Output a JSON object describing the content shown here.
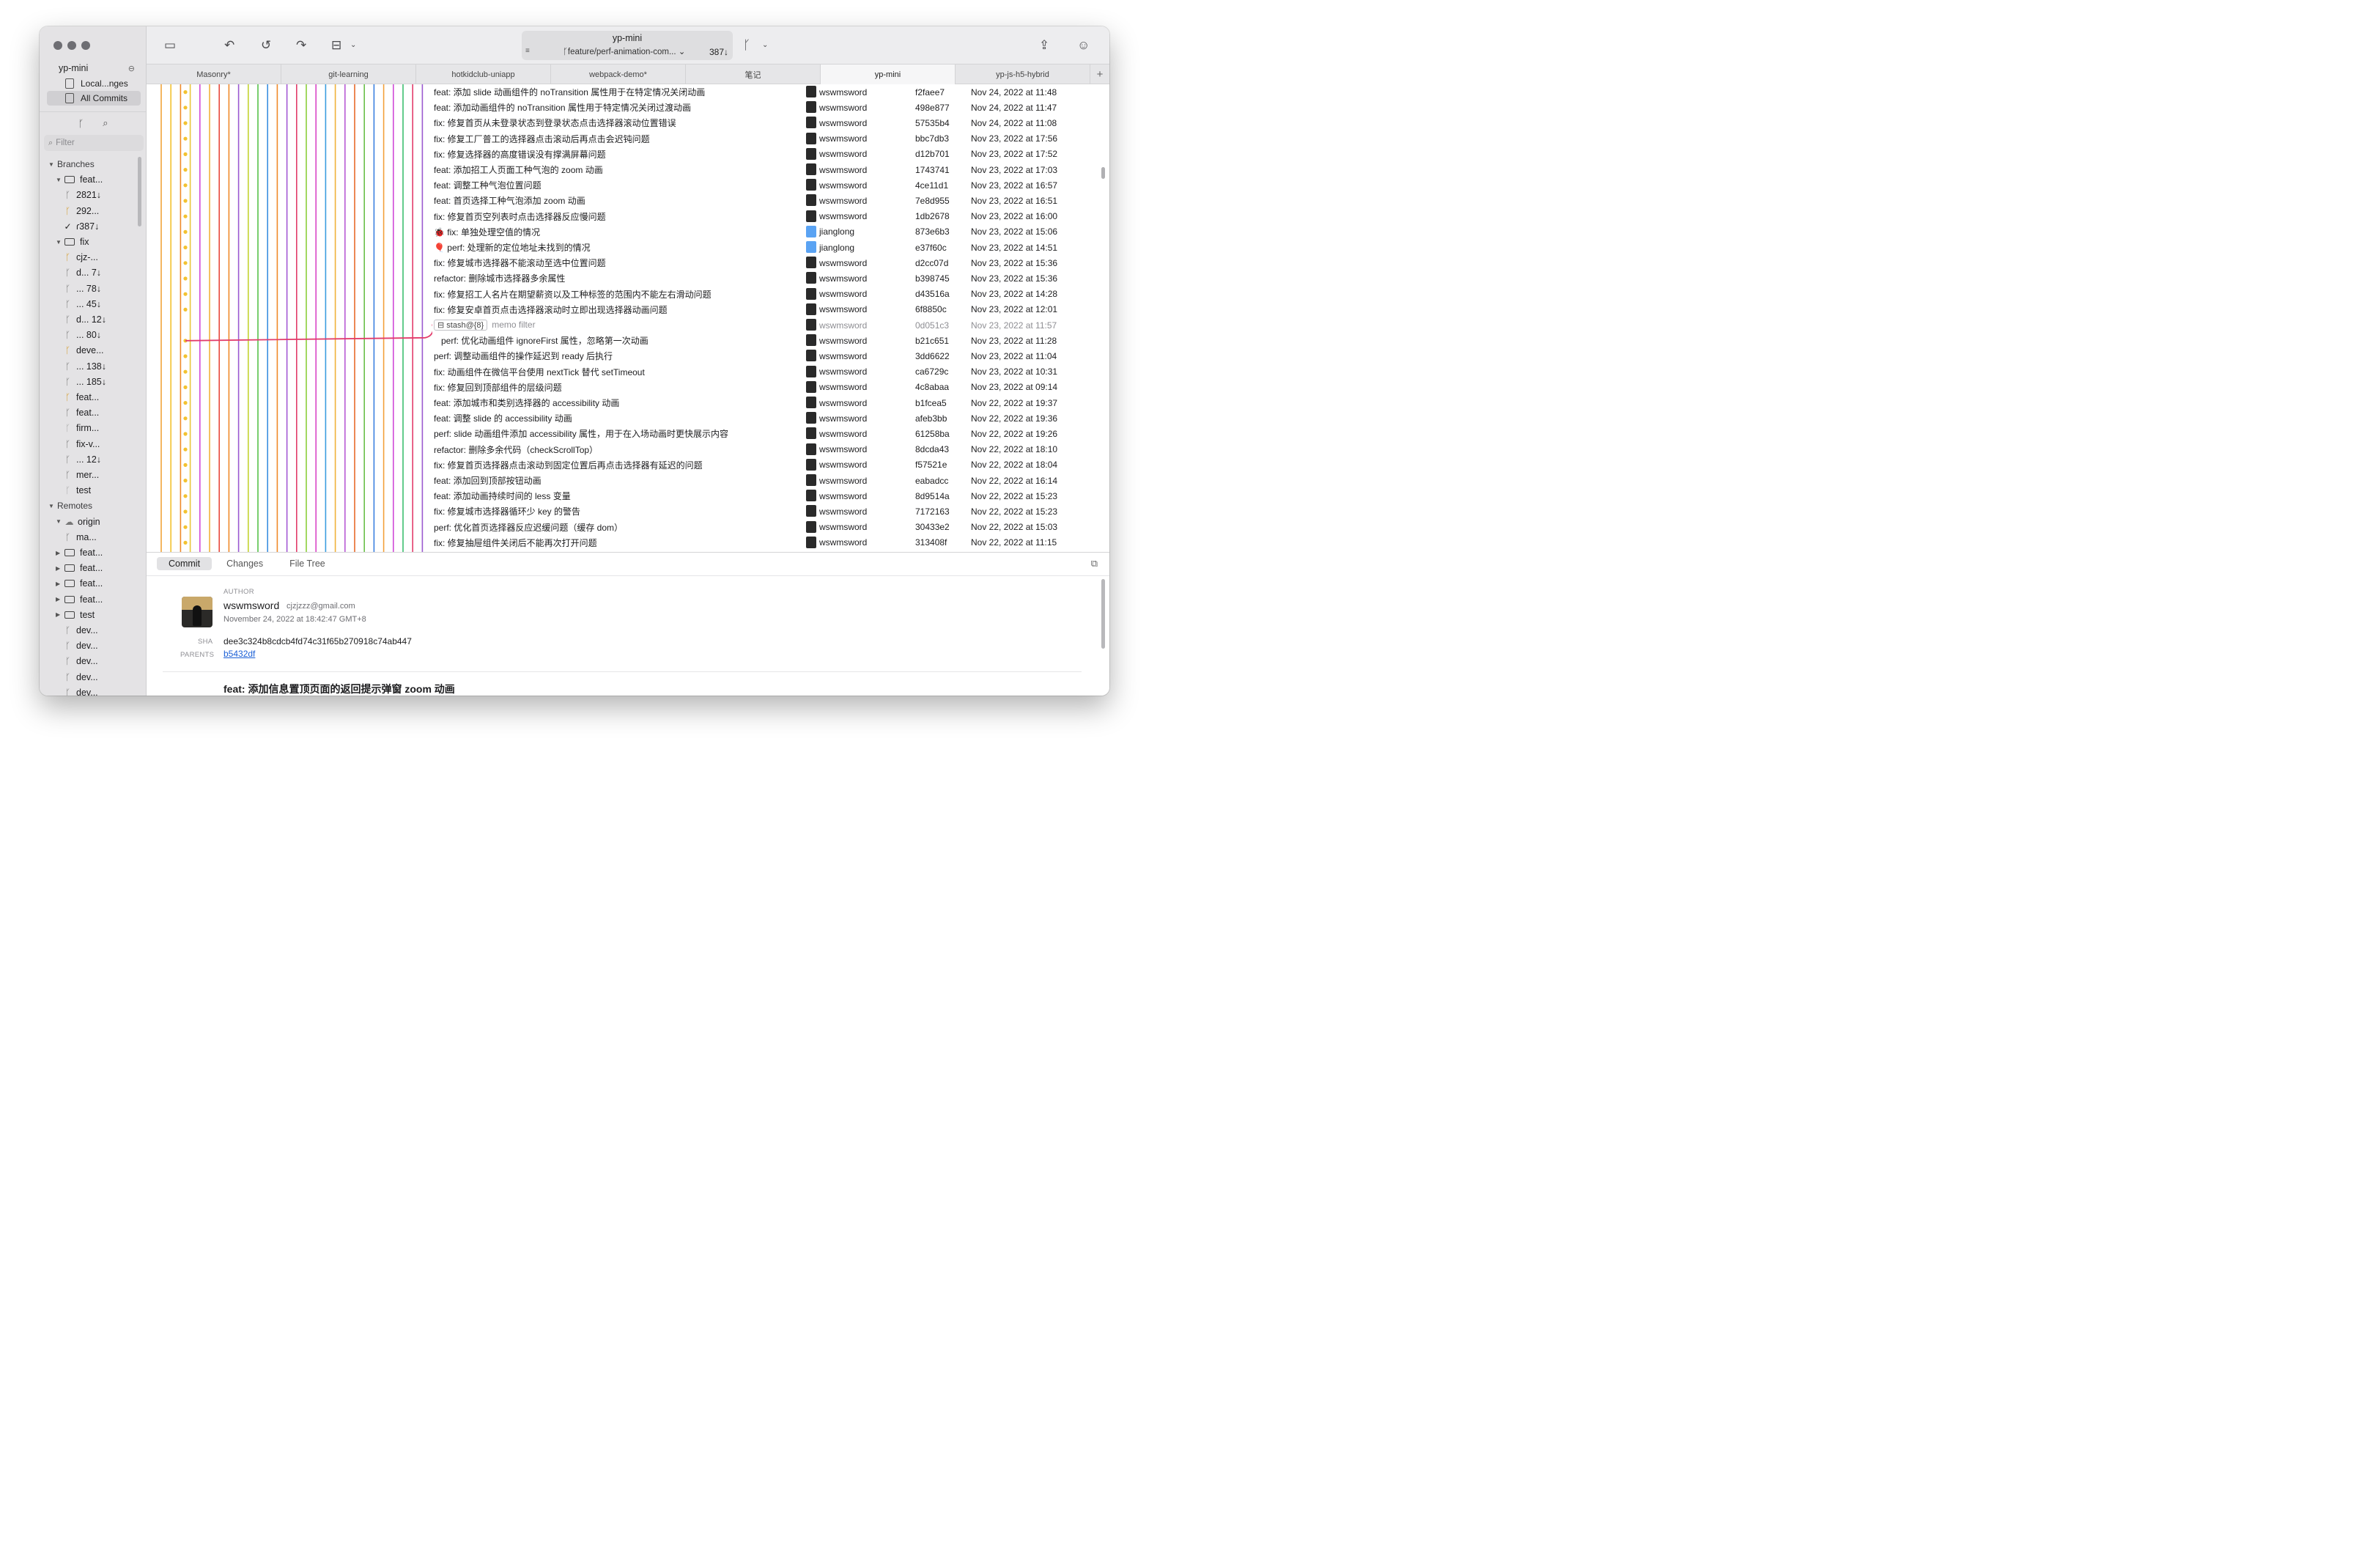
{
  "window": {
    "repo_name": "yp-mini"
  },
  "sidebar": {
    "repo_title": "yp-mini",
    "items": [
      {
        "label": "Local...nges"
      },
      {
        "label": "All Commits"
      }
    ],
    "filter_placeholder": "Filter",
    "sections": {
      "branches": "Branches",
      "remotes": "Remotes"
    },
    "tree": [
      {
        "label": "Branches",
        "kind": "header",
        "indent": 0
      },
      {
        "label": "feat...",
        "kind": "folder",
        "indent": 1
      },
      {
        "label": "2821↓",
        "kind": "branch",
        "indent": 2
      },
      {
        "label": "292...",
        "kind": "branch-warn",
        "indent": 2
      },
      {
        "label": "ɾ387↓",
        "kind": "current",
        "indent": 2
      },
      {
        "label": "fix",
        "kind": "folder",
        "indent": 1
      },
      {
        "label": "cjz-...",
        "kind": "branch-warn",
        "indent": 2
      },
      {
        "label": "d...  7↓",
        "kind": "branch",
        "indent": 2
      },
      {
        "label": "...  78↓",
        "kind": "branch",
        "indent": 2
      },
      {
        "label": "...  45↓",
        "kind": "branch",
        "indent": 2
      },
      {
        "label": "d... 12↓",
        "kind": "branch",
        "indent": 2
      },
      {
        "label": "...  80↓",
        "kind": "branch",
        "indent": 2
      },
      {
        "label": "deve...",
        "kind": "branch-warn",
        "indent": 2
      },
      {
        "label": "... 138↓",
        "kind": "branch",
        "indent": 2
      },
      {
        "label": "... 185↓",
        "kind": "branch",
        "indent": 2
      },
      {
        "label": "feat...",
        "kind": "branch-warn",
        "indent": 2
      },
      {
        "label": "feat...",
        "kind": "branch",
        "indent": 2
      },
      {
        "label": "firm...",
        "kind": "branch-dim",
        "indent": 2
      },
      {
        "label": "fix-v...",
        "kind": "branch",
        "indent": 2
      },
      {
        "label": "...  12↓",
        "kind": "branch",
        "indent": 2
      },
      {
        "label": "mer...",
        "kind": "branch",
        "indent": 2
      },
      {
        "label": "test",
        "kind": "branch-dim",
        "indent": 2
      },
      {
        "label": "Remotes",
        "kind": "header",
        "indent": 0
      },
      {
        "label": "origin",
        "kind": "remote",
        "indent": 1
      },
      {
        "label": "ma...",
        "kind": "branch",
        "indent": 2
      },
      {
        "label": "feat...",
        "kind": "folder-closed",
        "indent": 1
      },
      {
        "label": "feat...",
        "kind": "folder-closed",
        "indent": 1
      },
      {
        "label": "feat...",
        "kind": "folder-closed",
        "indent": 1
      },
      {
        "label": "feat...",
        "kind": "folder-closed",
        "indent": 1
      },
      {
        "label": "test",
        "kind": "folder-closed",
        "indent": 1
      },
      {
        "label": "dev...",
        "kind": "branch",
        "indent": 2
      },
      {
        "label": "dev...",
        "kind": "branch",
        "indent": 2
      },
      {
        "label": "dev...",
        "kind": "branch",
        "indent": 2
      },
      {
        "label": "dev...",
        "kind": "branch",
        "indent": 2
      },
      {
        "label": "dev...",
        "kind": "branch",
        "indent": 2
      }
    ]
  },
  "toolbar": {
    "title": "yp-mini",
    "branch": "feature/perf-animation-com...",
    "behind": "387↓"
  },
  "tabs": [
    {
      "label": "Masonry*",
      "active": false
    },
    {
      "label": "git-learning",
      "active": false
    },
    {
      "label": "hotkidclub-uniapp",
      "active": false
    },
    {
      "label": "webpack-demo*",
      "active": false
    },
    {
      "label": "笔记",
      "active": false
    },
    {
      "label": "yp-mini",
      "active": true
    },
    {
      "label": "yp-js-h5-hybrid",
      "active": false
    },
    {
      "label": "+",
      "active": false
    }
  ],
  "commits": [
    {
      "msg": "feat: 添加 slide 动画组件的 noTransition 属性用于在特定情况关闭动画",
      "author": "wswmsword",
      "sha": "f2faee7",
      "date": "Nov 24, 2022 at 11:48"
    },
    {
      "msg": "feat: 添加动画组件的 noTransition 属性用于特定情况关闭过渡动画",
      "author": "wswmsword",
      "sha": "498e877",
      "date": "Nov 24, 2022 at 11:47"
    },
    {
      "msg": "fix: 修复首页从未登录状态到登录状态点击选择器滚动位置错误",
      "author": "wswmsword",
      "sha": "57535b4",
      "date": "Nov 24, 2022 at 11:08"
    },
    {
      "msg": "fix: 修复工厂普工的选择器点击滚动后再点击会迟钝问题",
      "author": "wswmsword",
      "sha": "bbc7db3",
      "date": "Nov 23, 2022 at 17:56"
    },
    {
      "msg": "fix: 修复选择器的高度错误没有撑满屏幕问题",
      "author": "wswmsword",
      "sha": "d12b701",
      "date": "Nov 23, 2022 at 17:52"
    },
    {
      "msg": "feat: 添加招工人页面工种气泡的 zoom 动画",
      "author": "wswmsword",
      "sha": "1743741",
      "date": "Nov 23, 2022 at 17:03"
    },
    {
      "msg": "feat: 调整工种气泡位置问题",
      "author": "wswmsword",
      "sha": "4ce11d1",
      "date": "Nov 23, 2022 at 16:57"
    },
    {
      "msg": "feat: 首页选择工种气泡添加 zoom 动画",
      "author": "wswmsword",
      "sha": "7e8d955",
      "date": "Nov 23, 2022 at 16:51"
    },
    {
      "msg": "fix: 修复首页空列表时点击选择器反应慢问题",
      "author": "wswmsword",
      "sha": "1db2678",
      "date": "Nov 23, 2022 at 16:00"
    },
    {
      "msg": "🐞 fix: 单独处理空值的情况",
      "author": "jianglong",
      "sha": "873e6b3",
      "date": "Nov 23, 2022 at 15:06"
    },
    {
      "msg": "🎈 perf: 处理新的定位地址未找到的情况",
      "author": "jianglong",
      "sha": "e37f60c",
      "date": "Nov 23, 2022 at 14:51"
    },
    {
      "msg": "fix: 修复城市选择器不能滚动至选中位置问题",
      "author": "wswmsword",
      "sha": "d2cc07d",
      "date": "Nov 23, 2022 at 15:36"
    },
    {
      "msg": "refactor: 删除城市选择器多余属性",
      "author": "wswmsword",
      "sha": "b398745",
      "date": "Nov 23, 2022 at 15:36"
    },
    {
      "msg": "fix: 修复招工人名片在期望薪资以及工种标签的范围内不能左右滑动问题",
      "author": "wswmsword",
      "sha": "d43516a",
      "date": "Nov 23, 2022 at 14:28"
    },
    {
      "msg": "fix: 修复安卓首页点击选择器滚动时立即出现选择器动画问题",
      "author": "wswmsword",
      "sha": "6f8850c",
      "date": "Nov 23, 2022 at 12:01"
    },
    {
      "msg": "memo filter",
      "stash": "stash@{8}",
      "author": "wswmsword",
      "sha": "0d051c3",
      "date": "Nov 23, 2022 at 11:57"
    },
    {
      "msg": "perf: 优化动画组件 ignoreFirst 属性，忽略第一次动画",
      "author": "wswmsword",
      "sha": "b21c651",
      "date": "Nov 23, 2022 at 11:28"
    },
    {
      "msg": "perf: 调整动画组件的操作延迟到 ready 后执行",
      "author": "wswmsword",
      "sha": "3dd6622",
      "date": "Nov 23, 2022 at 11:04"
    },
    {
      "msg": "fix: 动画组件在微信平台使用 nextTick 替代 setTimeout",
      "author": "wswmsword",
      "sha": "ca6729c",
      "date": "Nov 23, 2022 at 10:31"
    },
    {
      "msg": "fix: 修复回到顶部组件的层级问题",
      "author": "wswmsword",
      "sha": "4c8abaa",
      "date": "Nov 23, 2022 at 09:14"
    },
    {
      "msg": "feat: 添加城市和类别选择器的 accessibility 动画",
      "author": "wswmsword",
      "sha": "b1fcea5",
      "date": "Nov 22, 2022 at 19:37"
    },
    {
      "msg": "feat: 调整 slide 的 accessibility 动画",
      "author": "wswmsword",
      "sha": "afeb3bb",
      "date": "Nov 22, 2022 at 19:36"
    },
    {
      "msg": "perf: slide 动画组件添加 accessibility 属性，用于在入场动画时更快展示内容",
      "author": "wswmsword",
      "sha": "61258ba",
      "date": "Nov 22, 2022 at 19:26"
    },
    {
      "msg": "refactor: 删除多余代码（checkScrollTop）",
      "author": "wswmsword",
      "sha": "8dcda43",
      "date": "Nov 22, 2022 at 18:10"
    },
    {
      "msg": "fix: 修复首页选择器点击滚动到固定位置后再点击选择器有延迟的问题",
      "author": "wswmsword",
      "sha": "f57521e",
      "date": "Nov 22, 2022 at 18:04"
    },
    {
      "msg": "feat: 添加回到顶部按钮动画",
      "author": "wswmsword",
      "sha": "eabadcc",
      "date": "Nov 22, 2022 at 16:14"
    },
    {
      "msg": "feat: 添加动画持续时间的 less 变量",
      "author": "wswmsword",
      "sha": "8d9514a",
      "date": "Nov 22, 2022 at 15:23"
    },
    {
      "msg": "fix: 修复城市选择器循环少 key 的警告",
      "author": "wswmsword",
      "sha": "7172163",
      "date": "Nov 22, 2022 at 15:23"
    },
    {
      "msg": "perf: 优化首页选择器反应迟缓问题（缓存 dom）",
      "author": "wswmsword",
      "sha": "30433e2",
      "date": "Nov 22, 2022 at 15:03"
    },
    {
      "msg": "fix: 修复抽屉组件关闭后不能再次打开问题",
      "author": "wswmsword",
      "sha": "313408f",
      "date": "Nov 22, 2022 at 11:15"
    }
  ],
  "graph_colors": [
    "#f2a33a",
    "#f2c230",
    "#ef8a2a",
    "#e9c73a",
    "#d04ad7",
    "#f0b23a",
    "#e8493d",
    "#f08a2a",
    "#9b59d0",
    "#c3d330",
    "#56c14a",
    "#3b8fe0",
    "#f08a2a",
    "#a358d4",
    "#e23c6b",
    "#8bcf3a",
    "#d948c8",
    "#3a9de0",
    "#f0b23a",
    "#b85ad4",
    "#e86a2a",
    "#6ac04a",
    "#3b7fe0",
    "#f3a03a",
    "#d04ad7",
    "#3cbf70",
    "#e23c6b",
    "#9b59d0"
  ],
  "detail": {
    "tabs": [
      "Commit",
      "Changes",
      "File Tree"
    ],
    "author_label": "AUTHOR",
    "author": "wswmsword",
    "email": "cjzjzzz@gmail.com",
    "date": "November 24, 2022 at 18:42:47 GMT+8",
    "sha_label": "SHA",
    "sha": "dee3c324b8cdcb4fd74c31f65b270918c74ab447",
    "parents_label": "PARENTS",
    "parent": "b5432df",
    "subject": "feat: 添加信息置顶页面的返回提示弹窗 zoom 动画"
  }
}
